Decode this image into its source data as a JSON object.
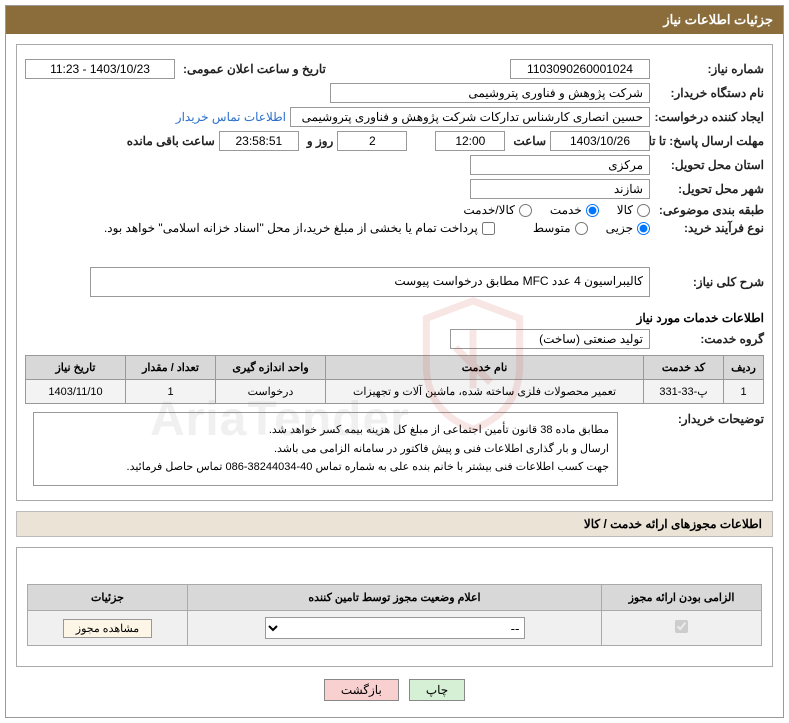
{
  "header": {
    "title": "جزئیات اطلاعات نیاز"
  },
  "form": {
    "need_number_label": "شماره نیاز:",
    "need_number": "1103090260001024",
    "announce_label": "تاریخ و ساعت اعلان عمومی:",
    "announce_value": "1403/10/23 - 11:23",
    "buyer_org_label": "نام دستگاه خریدار:",
    "buyer_org": "شرکت پژوهش و فناوری پتروشیمی",
    "requester_label": "ایجاد کننده درخواست:",
    "requester": "حسین انصاری کارشناس تدارکات شرکت پژوهش و فناوری پتروشیمی",
    "contact_link": "اطلاعات تماس خریدار",
    "deadline_label": "مهلت ارسال پاسخ: تا تاریخ:",
    "deadline_date": "1403/10/26",
    "time_label": "ساعت",
    "deadline_time": "12:00",
    "days_value": "2",
    "days_and": "روز و",
    "remain_time": "23:58:51",
    "remain_label": "ساعت باقی مانده",
    "province_label": "استان محل تحویل:",
    "province": "مرکزی",
    "city_label": "شهر محل تحویل:",
    "city": "شازند",
    "category_label": "طبقه بندی موضوعی:",
    "cat_goods": "کالا",
    "cat_service": "خدمت",
    "cat_both": "کالا/خدمت",
    "process_label": "نوع فرآیند خرید:",
    "proc_partial": "جزیی",
    "proc_medium": "متوسط",
    "treasury_note": "پرداخت تمام یا بخشی از مبلغ خرید،از محل \"اسناد خزانه اسلامی\" خواهد بود.",
    "summary_label": "شرح کلی نیاز:",
    "summary": "کالیبراسیون 4 عدد MFC مطابق درخواست پیوست",
    "services_info_label": "اطلاعات خدمات مورد نیاز",
    "service_group_label": "گروه خدمت:",
    "service_group": "تولید صنعتی (ساخت)"
  },
  "table": {
    "headers": {
      "row": "ردیف",
      "code": "کد خدمت",
      "name": "نام خدمت",
      "unit": "واحد اندازه گیری",
      "qty": "تعداد / مقدار",
      "date": "تاریخ نیاز"
    },
    "rows": [
      {
        "row": "1",
        "code": "پ-33-331",
        "name": "تعمیر محصولات فلزی ساخته شده، ماشین آلات و تجهیزات",
        "unit": "درخواست",
        "qty": "1",
        "date": "1403/11/10"
      }
    ]
  },
  "buyer_note": {
    "label": "توضیحات خریدار:",
    "line1": "مطابق ماده 38 قانون تأمین اجتماعی از مبلغ کل هزینه بیمه کسر خواهد شد.",
    "line2": "ارسال و بار گذاری اطلاعات فنی و پیش فاکتور در سامانه الزامی می باشد.",
    "line3": "جهت کسب اطلاعات فنی بیشتر با خانم بنده علی به شماره تماس 40-38244034-086 تماس حاصل فرمائید."
  },
  "license": {
    "section_title": "اطلاعات مجوزهای ارائه خدمت / کالا",
    "headers": {
      "required": "الزامی بودن ارائه مجوز",
      "status": "اعلام وضعیت مجوز توسط تامین کننده",
      "details": "جزئیات"
    },
    "select_placeholder": "--",
    "view_btn": "مشاهده مجوز"
  },
  "buttons": {
    "print": "چاپ",
    "back": "بازگشت"
  },
  "watermark": {
    "text": "AriaTender"
  }
}
